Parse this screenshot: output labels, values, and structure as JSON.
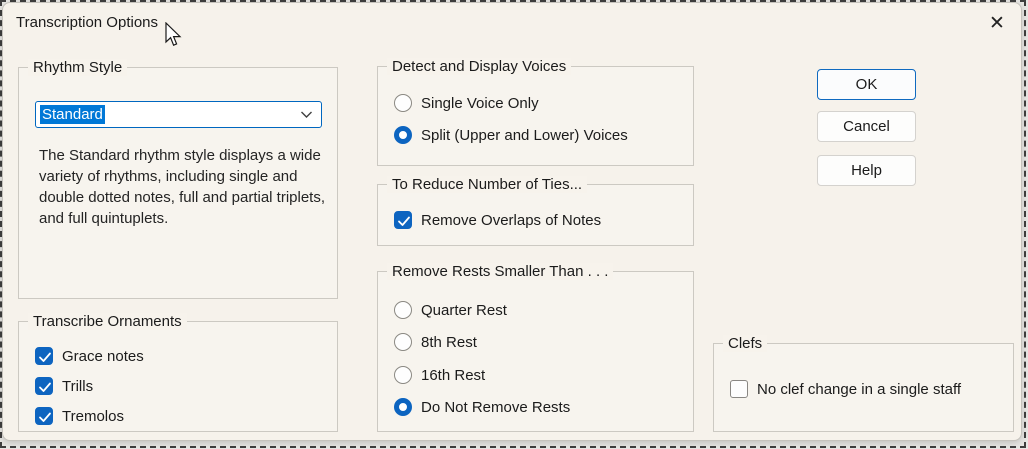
{
  "dialog": {
    "title": "Transcription Options"
  },
  "icons": {
    "close": "✕"
  },
  "colors": {
    "accent": "#0d64c0",
    "selection_highlight": "#0078d7",
    "focus_border": "#0067c0",
    "dialog_bg": "#f6f2eb"
  },
  "rhythm_style": {
    "group_label": "Rhythm Style",
    "dropdown_value": "Standard",
    "dropdown_state": "focused, text selected",
    "description": "The Standard rhythm style displays a wide variety of rhythms, including single and double dotted notes, full and partial triplets, and full quintuplets."
  },
  "transcribe_ornaments": {
    "group_label": "Transcribe Ornaments",
    "items": [
      {
        "label": "Grace notes",
        "checked": true
      },
      {
        "label": "Trills",
        "checked": true
      },
      {
        "label": "Tremolos",
        "checked": true
      }
    ]
  },
  "detect_voices": {
    "group_label": "Detect and Display Voices",
    "options": [
      {
        "label": "Single Voice Only",
        "selected": false
      },
      {
        "label": "Split (Upper and Lower) Voices",
        "selected": true
      }
    ]
  },
  "reduce_ties": {
    "group_label": "To Reduce Number of Ties...",
    "items": [
      {
        "label": "Remove Overlaps of Notes",
        "checked": true
      }
    ]
  },
  "remove_rests": {
    "group_label": "Remove Rests Smaller Than . . .",
    "options": [
      {
        "label": "Quarter Rest",
        "selected": false
      },
      {
        "label": "8th Rest",
        "selected": false
      },
      {
        "label": "16th Rest",
        "selected": false
      },
      {
        "label": "Do Not Remove Rests",
        "selected": true
      }
    ]
  },
  "clefs": {
    "group_label": "Clefs",
    "items": [
      {
        "label": "No clef change in a single staff",
        "checked": false
      }
    ]
  },
  "buttons": {
    "ok": "OK",
    "cancel": "Cancel",
    "help": "Help"
  }
}
